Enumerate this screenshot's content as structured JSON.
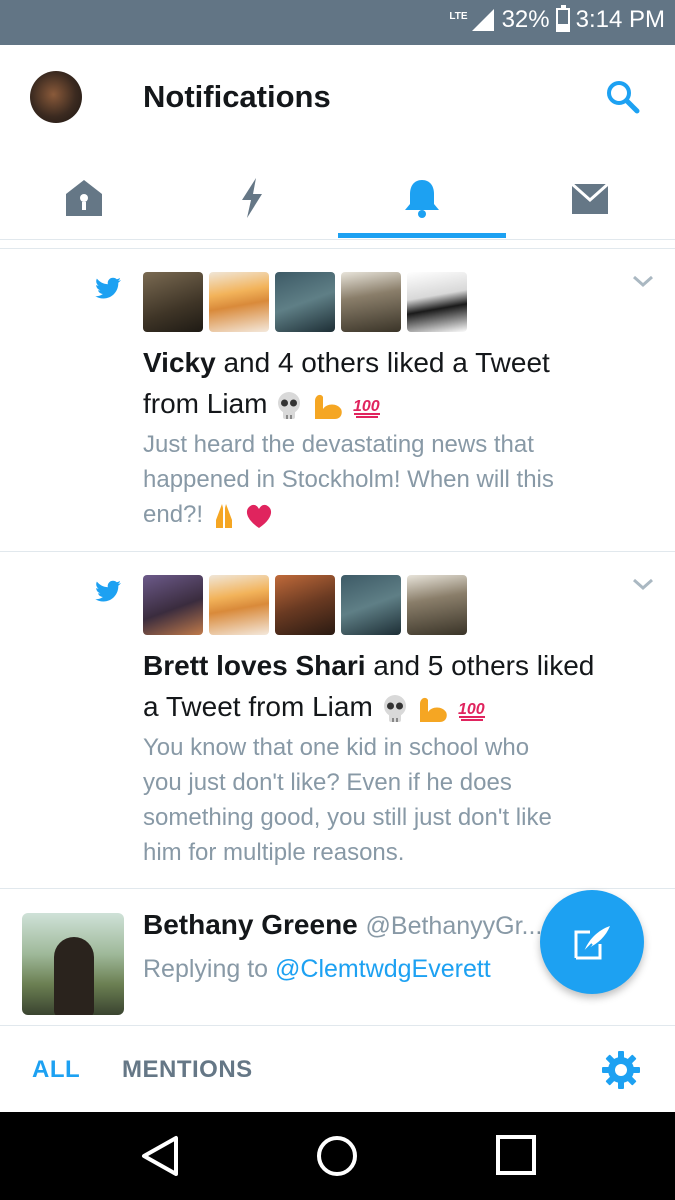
{
  "status_bar": {
    "network": "LTE",
    "battery_percent": "32%",
    "battery_level": 0.32,
    "time": "3:14 PM",
    "bg_color": "#627585"
  },
  "header": {
    "title": "Notifications",
    "search_icon": "search-icon"
  },
  "tabs": [
    {
      "name": "home",
      "icon": "home-icon",
      "active": false
    },
    {
      "name": "moments",
      "icon": "lightning-icon",
      "active": false
    },
    {
      "name": "notifications",
      "icon": "bell-icon",
      "active": true
    },
    {
      "name": "messages",
      "icon": "envelope-icon",
      "active": false
    }
  ],
  "notifications": [
    {
      "icon": "twitter-bird-icon",
      "actor": "Vicky",
      "action_line1": " and 4 others liked a Tweet",
      "action_line2": "from Liam",
      "tweet_line1": "Just heard the devastating news that",
      "tweet_line2": "happened in Stockholm! When will this",
      "tweet_line3": "end?!"
    },
    {
      "icon": "twitter-bird-icon",
      "actor": "Brett loves Shari",
      "action_line1": " and 5 others liked",
      "action_line2": "a Tweet from Liam",
      "tweet_line1": "You know that one kid in school who",
      "tweet_line2": "you just don't like? Even if he does",
      "tweet_line3": "something good, you still just don't like",
      "tweet_line4": "him for multiple reasons."
    }
  ],
  "reply": {
    "name": "Bethany Greene",
    "handle": "@BethanyyGr...",
    "replying_prefix": "Replying to ",
    "replying_to": "@ClemtwdgEverett"
  },
  "bottom_bar": {
    "all_label": "ALL",
    "mentions_label": "MENTIONS",
    "settings_icon": "gear-icon"
  },
  "accent_color": "#1da1f2"
}
